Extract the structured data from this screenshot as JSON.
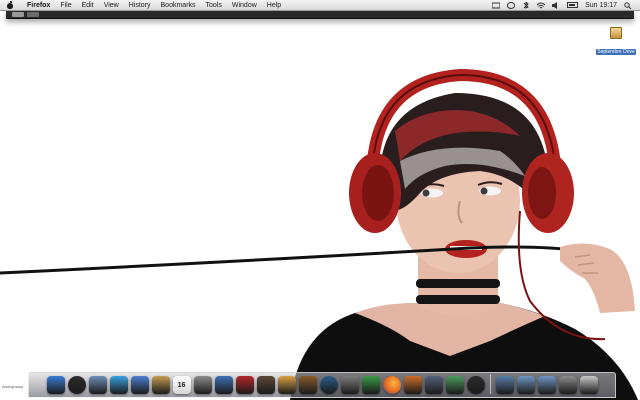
{
  "menubar": {
    "app_name": "Firefox",
    "items": [
      "File",
      "Edit",
      "View",
      "History",
      "Bookmarks",
      "Tools",
      "Window",
      "Help"
    ],
    "clock": "Sun 19:17"
  },
  "desktop": {
    "drive_label": "Septembre Drive",
    "caption": "Anonymous"
  },
  "dock": {
    "apps": [
      {
        "name": "finder-icon",
        "color": "#3b7bd6"
      },
      {
        "name": "dashboard-icon",
        "color": "#2b2b2b"
      },
      {
        "name": "mail-icon",
        "color": "#6f8fb8"
      },
      {
        "name": "safari-icon",
        "color": "#3aa0e0"
      },
      {
        "name": "ichat-icon",
        "color": "#4c7fd1"
      },
      {
        "name": "address-book-icon",
        "color": "#c79b52"
      },
      {
        "name": "ical-icon",
        "color": "#e8e8e8"
      },
      {
        "name": "preview-icon",
        "color": "#8d8d8d"
      },
      {
        "name": "itunes-icon",
        "color": "#3d6fb5"
      },
      {
        "name": "photo-booth-icon",
        "color": "#b5262a"
      },
      {
        "name": "iphoto-icon",
        "color": "#5a4738"
      },
      {
        "name": "garageband-icon",
        "color": "#d9a046"
      },
      {
        "name": "guitar-icon",
        "color": "#8a5a2b"
      },
      {
        "name": "time-machine-icon",
        "color": "#2e5c8a"
      },
      {
        "name": "system-preferences-icon",
        "color": "#7d7d7d"
      },
      {
        "name": "people-icon",
        "color": "#3a9b46"
      },
      {
        "name": "firefox-icon",
        "color": "#e66a1f"
      },
      {
        "name": "keynote-icon",
        "color": "#ce6d2a"
      },
      {
        "name": "script-icon",
        "color": "#55627a"
      },
      {
        "name": "chart-icon",
        "color": "#4a9a5e"
      },
      {
        "name": "dvd-icon",
        "color": "#2d2d2d"
      }
    ],
    "stack": [
      {
        "name": "folder-icon",
        "color": "#5a7ea6"
      },
      {
        "name": "documents-folder-icon",
        "color": "#6f95c1"
      },
      {
        "name": "downloads-folder-icon",
        "color": "#6f95c1"
      },
      {
        "name": "device-icon",
        "color": "#8b8b8b"
      },
      {
        "name": "trash-icon",
        "color": "#c9c9c9"
      }
    ],
    "ical_date": "16"
  }
}
